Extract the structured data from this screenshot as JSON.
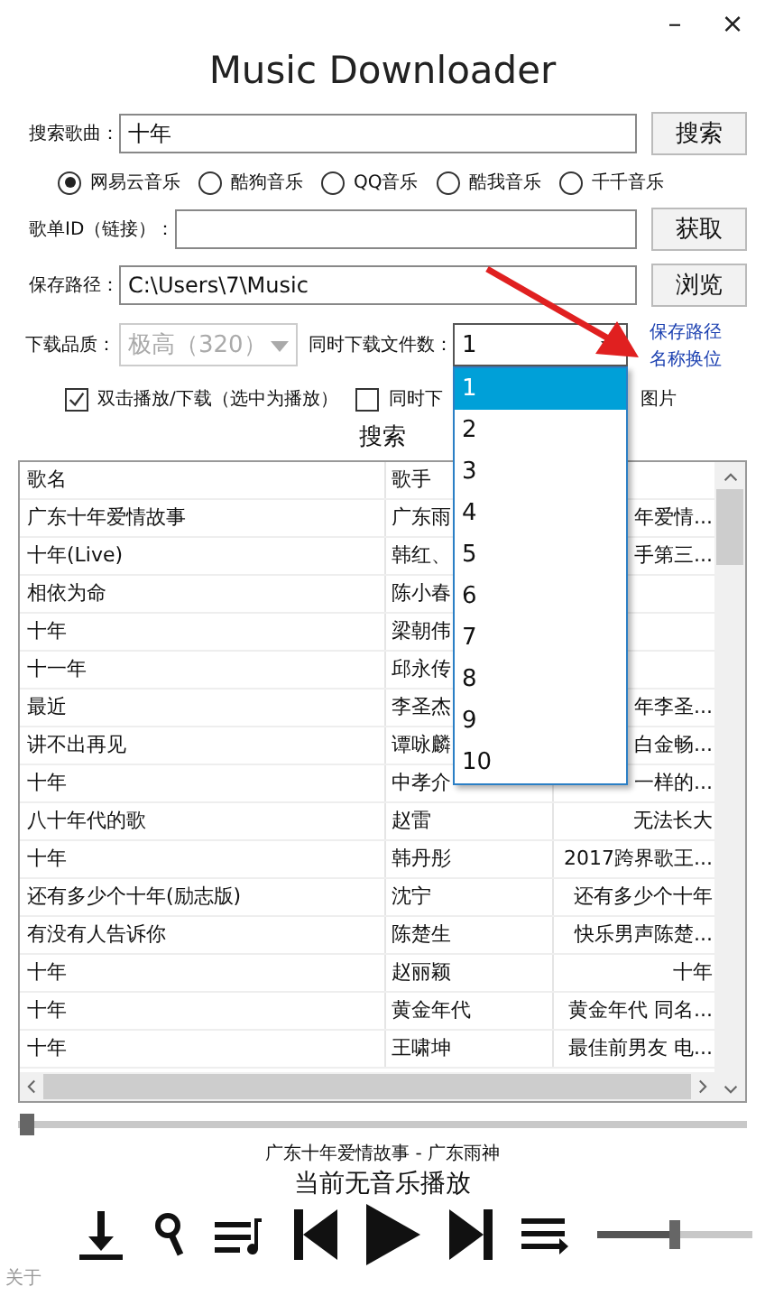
{
  "window": {
    "title": "Music Downloader",
    "minimize": "–",
    "close": "×"
  },
  "search": {
    "label": "搜索歌曲：",
    "value": "十年",
    "button": "搜索"
  },
  "sources": [
    {
      "label": "网易云音乐",
      "selected": true
    },
    {
      "label": "酷狗音乐",
      "selected": false
    },
    {
      "label": "QQ音乐",
      "selected": false
    },
    {
      "label": "酷我音乐",
      "selected": false
    },
    {
      "label": "千千音乐",
      "selected": false
    }
  ],
  "playlist": {
    "label": "歌单ID（链接）：",
    "button": "获取"
  },
  "save_path": {
    "label": "保存路径：",
    "value": "C:\\Users\\7\\Music",
    "button": "浏览"
  },
  "quality": {
    "label": "下载品质：",
    "value": "极高（320）",
    "disabled": true
  },
  "concurrent": {
    "label": "同时下载文件数：",
    "value": "1",
    "expanded": true,
    "options": [
      {
        "label": "1",
        "selected": true
      },
      {
        "label": "2",
        "selected": false
      },
      {
        "label": "3",
        "selected": false
      },
      {
        "label": "4",
        "selected": false
      },
      {
        "label": "5",
        "selected": false
      },
      {
        "label": "6",
        "selected": false
      },
      {
        "label": "7",
        "selected": false
      },
      {
        "label": "8",
        "selected": false
      },
      {
        "label": "9",
        "selected": false
      },
      {
        "label": "10",
        "selected": false
      }
    ]
  },
  "links": [
    "保存路径",
    "名称换位"
  ],
  "options": [
    {
      "label": "双击播放/下载（选中为播放）",
      "checked": true
    },
    {
      "label": "同时下",
      "checked": false,
      "tail": "图片"
    }
  ],
  "results_label": "搜索",
  "table": {
    "columns": [
      "歌名",
      "歌手"
    ],
    "rows": [
      {
        "cells": [
          "广东十年爱情故事",
          "广东雨",
          "年爱情..."
        ]
      },
      {
        "cells": [
          "十年(Live)",
          "韩红、",
          "手第三..."
        ]
      },
      {
        "cells": [
          "相依为命",
          "陈小春"
        ]
      },
      {
        "cells": [
          "十年",
          "梁朝伟"
        ]
      },
      {
        "cells": [
          "十一年",
          "邱永传"
        ]
      },
      {
        "cells": [
          "最近",
          "李圣杰",
          "年李圣..."
        ]
      },
      {
        "cells": [
          "讲不出再见",
          "谭咏麟",
          "白金畅..."
        ]
      },
      {
        "cells": [
          "十年",
          "中孝介",
          "一样的..."
        ]
      },
      {
        "cells": [
          "八十年代的歌",
          "赵雷",
          "无法长大"
        ]
      },
      {
        "cells": [
          "十年",
          "韩丹彤",
          "2017跨界歌王..."
        ]
      },
      {
        "cells": [
          "还有多少个十年(励志版)",
          "沈宁",
          "还有多少个十年"
        ]
      },
      {
        "cells": [
          "有没有人告诉你",
          "陈楚生",
          "快乐男声陈楚..."
        ]
      },
      {
        "cells": [
          "十年",
          "赵丽颖",
          "十年"
        ]
      },
      {
        "cells": [
          "十年",
          "黄金年代",
          "黄金年代 同名..."
        ]
      },
      {
        "cells": [
          "十年",
          "王啸坤",
          "最佳前男友 电..."
        ]
      }
    ]
  },
  "progress": {
    "level": 0
  },
  "now_playing": "广东十年爱情故事 - 广东雨神",
  "status": "当前无音乐播放",
  "volume": {
    "level": 0.5
  },
  "about": "关于"
}
